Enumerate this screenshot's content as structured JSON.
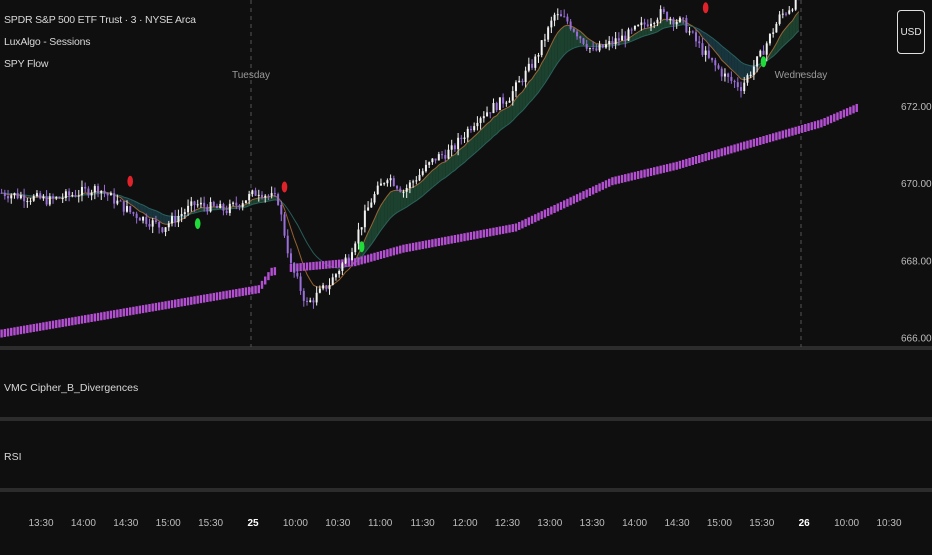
{
  "legend": {
    "symbol_line": "SPDR S&P 500 ETF Trust · 3 · NYSE Arca",
    "indicator_1": "LuxAlgo - Sessions",
    "indicator_2": "SPY Flow"
  },
  "currency_button": "USD",
  "session_labels": [
    {
      "text": "Tuesday",
      "x": 250
    },
    {
      "text": "Wednesday",
      "x": 801
    }
  ],
  "panes": {
    "vmc": "VMC Cipher_B_Divergences",
    "rsi": "RSI"
  },
  "colors": {
    "background": "#0f0f0f",
    "bull_candle": "#f2f2f2",
    "bear_candle": "#9a6fd8",
    "flow": "#b44fd4",
    "cloud_green": "#1f4a34",
    "cloud_teal": "#1a3b45",
    "sell_dot": "#e0232b",
    "buy_dot": "#1fdc3a",
    "separator": "#4a4a4a"
  },
  "chart_data": {
    "type": "candlestick",
    "title": "SPDR S&P 500 ETF Trust · 3 · NYSE Arca",
    "ylim": [
      665.75,
      674.75
    ],
    "y_ticks": [
      "666.00",
      "668.00",
      "670.00",
      "672.00"
    ],
    "x_ticks": [
      "13:30",
      "14:00",
      "14:30",
      "15:00",
      "15:30",
      "25",
      "10:00",
      "10:30",
      "11:00",
      "11:30",
      "12:00",
      "12:30",
      "13:00",
      "13:30",
      "14:00",
      "14:30",
      "15:00",
      "15:30",
      "26",
      "10:00",
      "10:30"
    ],
    "bold_ticks": [
      "25",
      "26"
    ],
    "session_breaks": [
      "25",
      "26"
    ],
    "price_series": [
      {
        "index": 0,
        "price": 669.75
      },
      {
        "index": 15,
        "price": 669.55
      },
      {
        "index": 30,
        "price": 669.88
      },
      {
        "index": 40,
        "price": 669.25
      },
      {
        "index": 50,
        "price": 668.85
      },
      {
        "index": 60,
        "price": 669.45
      },
      {
        "index": 70,
        "price": 669.3
      },
      {
        "index": 80,
        "price": 669.8
      },
      {
        "index": 86,
        "price": 669.55
      },
      {
        "index": 90,
        "price": 667.85
      },
      {
        "index": 95,
        "price": 666.85
      },
      {
        "index": 102,
        "price": 667.4
      },
      {
        "index": 108,
        "price": 668.15
      },
      {
        "index": 115,
        "price": 669.55
      },
      {
        "index": 120,
        "price": 670.2
      },
      {
        "index": 125,
        "price": 669.8
      },
      {
        "index": 135,
        "price": 670.65
      },
      {
        "index": 140,
        "price": 670.85
      },
      {
        "index": 148,
        "price": 671.7
      },
      {
        "index": 158,
        "price": 672.25
      },
      {
        "index": 166,
        "price": 673.2
      },
      {
        "index": 172,
        "price": 674.35
      },
      {
        "index": 176,
        "price": 674.2
      },
      {
        "index": 184,
        "price": 673.4
      },
      {
        "index": 195,
        "price": 673.85
      },
      {
        "index": 205,
        "price": 674.4
      },
      {
        "index": 212,
        "price": 674.15
      },
      {
        "index": 220,
        "price": 673.2
      },
      {
        "index": 226,
        "price": 672.7
      },
      {
        "index": 230,
        "price": 672.5
      },
      {
        "index": 236,
        "price": 673.3
      },
      {
        "index": 242,
        "price": 674.3
      },
      {
        "index": 248,
        "price": 674.8
      }
    ],
    "flow_series": [
      {
        "index": 0,
        "value": 666.1
      },
      {
        "index": 80,
        "value": 667.25
      },
      {
        "index": 84,
        "value": 667.7
      },
      {
        "index": 90,
        "value": 667.8
      },
      {
        "index": 110,
        "value": 667.95
      },
      {
        "index": 125,
        "value": 668.3
      },
      {
        "index": 160,
        "value": 668.85
      },
      {
        "index": 175,
        "value": 669.45
      },
      {
        "index": 190,
        "value": 670.05
      },
      {
        "index": 210,
        "value": 670.45
      },
      {
        "index": 230,
        "value": 670.95
      },
      {
        "index": 255,
        "value": 671.55
      },
      {
        "index": 266,
        "value": 671.95
      }
    ],
    "signals": [
      {
        "type": "sell",
        "index": 40,
        "price": 670.05
      },
      {
        "type": "buy",
        "index": 61,
        "price": 668.95
      },
      {
        "type": "sell",
        "index": 88,
        "price": 669.9
      },
      {
        "type": "buy",
        "index": 112,
        "price": 668.35
      },
      {
        "type": "sell",
        "index": 219,
        "price": 674.55
      },
      {
        "type": "buy",
        "index": 237,
        "price": 673.15
      }
    ]
  }
}
